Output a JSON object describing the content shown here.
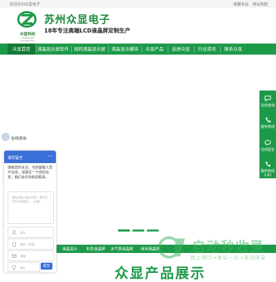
{
  "topbar": {
    "welcome": "欢迎访问众显电子",
    "links": [
      "收藏本站",
      "网站地图"
    ]
  },
  "header": {
    "logo_text": "众显科技",
    "logo_sub": "ZHONGXIAN TECHNOLOGY",
    "title": "苏州众显电子",
    "slogan": "18年专注高端LCD液晶屏定制生产"
  },
  "nav": {
    "items": [
      "众显首页",
      "液晶显示屏软件",
      "段码液晶显示屏",
      "液晶显示模块",
      "众显产品",
      "走进众显",
      "行业资讯",
      "联系众显"
    ],
    "active_index": 0
  },
  "right_sidebar": {
    "items": [
      {
        "label": "在线咨询",
        "icon": "chat-bubble-icon"
      },
      {
        "label": "服务热线",
        "icon": "phone-icon"
      },
      {
        "label": "在线留言",
        "icon": "comment-icon"
      },
      {
        "label": "服务热线1-81",
        "icon": "phone-icon"
      }
    ]
  },
  "chat_side": {
    "label": "在线咨询"
  },
  "chat": {
    "header": "请您留言",
    "message": "感谢您的关注，当前客服人员不在线，请填写一下您的信息，我们会尽快和您联系。",
    "textarea_placeholder": "请在此输入留言内容，我们会尽快与您联系。（必填）",
    "fields": [
      {
        "placeholder": "姓名",
        "icon": "user-icon"
      },
      {
        "placeholder": "电话（必填）",
        "icon": "phone-icon"
      },
      {
        "placeholder": "邮箱",
        "icon": "email-icon"
      },
      {
        "placeholder": "地址",
        "icon": "location-icon"
      }
    ],
    "submit": "提交"
  },
  "strip": {
    "items": [
      "液晶显示",
      "彩色液晶屏",
      "冰气表液晶屏",
      "商用液晶屏"
    ]
  },
  "section": {
    "title": "众显产品展示"
  },
  "watermark": {
    "big": "自动秒收录",
    "small": "数上排行→来访一次→自动收录"
  },
  "colors": {
    "brand_green": "#1d9a48",
    "chat_blue": "#3a6fd8"
  }
}
